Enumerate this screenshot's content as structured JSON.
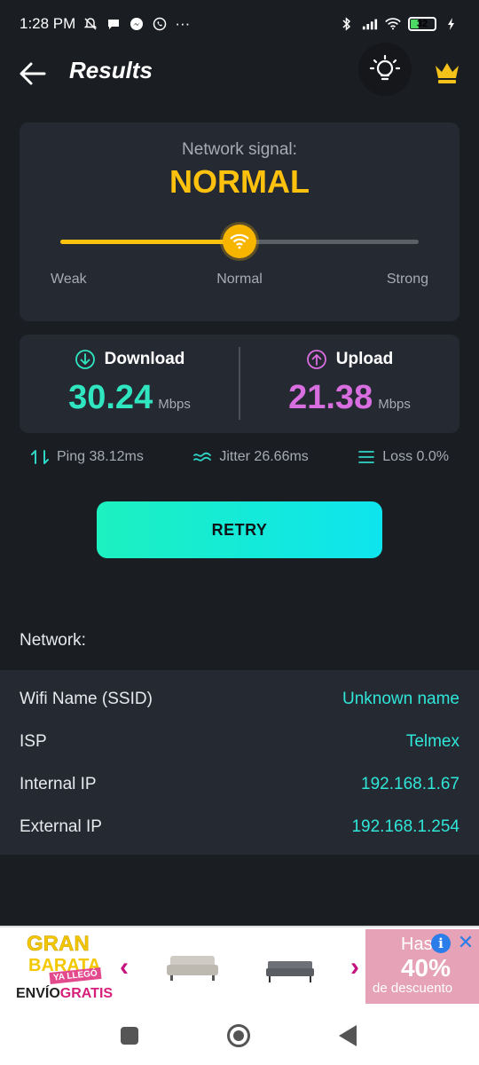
{
  "status_bar": {
    "time": "1:28 PM",
    "dots": "···",
    "battery": "32",
    "icons_left": [
      "notifications-off-icon",
      "chat-icon",
      "messenger-icon",
      "whatsapp-icon"
    ],
    "icons_right": [
      "bluetooth-icon",
      "cell-signal-icon",
      "wifi-icon",
      "battery-icon",
      "charging-icon"
    ]
  },
  "header": {
    "title": "Results",
    "icons": [
      "back-arrow-icon",
      "lightbulb-icon",
      "crown-icon"
    ]
  },
  "signal": {
    "label": "Network signal:",
    "value": "NORMAL",
    "level_fraction": 0.5,
    "ticks": {
      "weak": "Weak",
      "normal": "Normal",
      "strong": "Strong"
    },
    "accent": "#fec10d"
  },
  "speed": {
    "download": {
      "label": "Download",
      "value": "30.24",
      "unit": "Mbps",
      "color": "#2fe6c0"
    },
    "upload": {
      "label": "Upload",
      "value": "21.38",
      "unit": "Mbps",
      "color": "#d96ee0"
    }
  },
  "stats": {
    "ping": "Ping 38.12ms",
    "jitter": "Jitter 26.66ms",
    "loss": "Loss 0.0%"
  },
  "retry_label": "RETRY",
  "network": {
    "label": "Network:",
    "rows": [
      {
        "key": "Wifi Name (SSID)",
        "value": "Unknown name"
      },
      {
        "key": "ISP",
        "value": "Telmex"
      },
      {
        "key": "Internal IP",
        "value": "192.168.1.67"
      },
      {
        "key": "External IP",
        "value": "192.168.1.254"
      }
    ]
  },
  "ad": {
    "gran": "GRAN",
    "barata": "BARATA",
    "ya_llego": "YA LLEGÓ",
    "envio": "ENVÍO",
    "gratis": "GRATIS",
    "hasta": "Hasta",
    "pct": "40%",
    "descuento": "de descuento",
    "prev": "‹",
    "next": "›",
    "info": "i",
    "close": "✕"
  }
}
